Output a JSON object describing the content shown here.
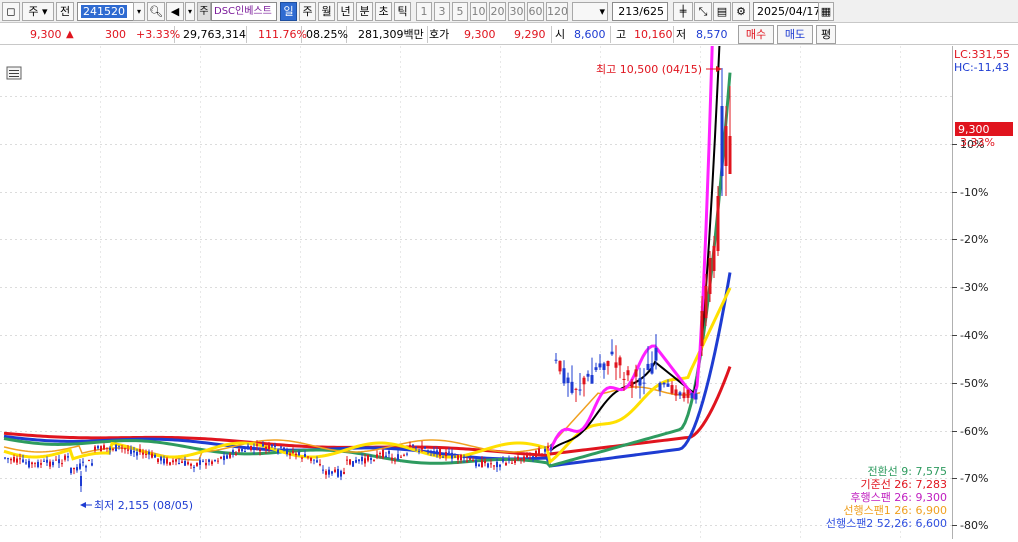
{
  "toolbar": {
    "type_label": "주",
    "period_label": "전",
    "code": "241520",
    "stock_name": "DSC인베스트",
    "period_buttons": [
      "일",
      "주",
      "월",
      "년",
      "분",
      "초",
      "틱"
    ],
    "interval_buttons": [
      "1",
      "3",
      "5",
      "10",
      "20",
      "30",
      "60",
      "120"
    ],
    "count": "213/625",
    "date": "2025/04/17"
  },
  "info": {
    "price": "9,300",
    "up_arrow": "▲",
    "change": "300",
    "change_pct": "+3.33%",
    "volume": "29,763,314",
    "volume_ratio": "111.76%",
    "turnover": "08.25%",
    "amount": "281,309백만",
    "quote_label": "호가",
    "ask": "9,300",
    "bid": "9,290",
    "open_label": "시",
    "open": "8,600",
    "high_label": "고",
    "high": "10,160",
    "low_label": "저",
    "low": "8,570",
    "buy_button": "매수",
    "sell_button": "매도",
    "eval_button": "평"
  },
  "chart": {
    "lc_label": "LC:331,55",
    "hc_label": "HC:-11,43",
    "y_ticks": [
      "10%",
      "-10%",
      "-20%",
      "-30%",
      "-40%",
      "-50%",
      "-60%",
      "-70%",
      "-80%"
    ],
    "price_tag": "9,300",
    "price_pct": "3.33%",
    "high_annotation": "최고 10,500 (04/15)",
    "low_annotation": "최저 2,155 (08/05)",
    "legend": [
      {
        "label": "전환선 9: 7,575",
        "color": "#2e9b5f"
      },
      {
        "label": "기준선 26: 7,283",
        "color": "#e0141e"
      },
      {
        "label": "후행스팬 26: 9,300",
        "color": "#c020c0"
      },
      {
        "label": "선행스팬1 26: 6,900",
        "color": "#f0a020"
      },
      {
        "label": "선행스팬2 52,26: 6,600",
        "color": "#3050e0"
      }
    ],
    "colors": {
      "up": "#e0141e",
      "down": "#1e3cd2",
      "ma5": "#ff20ff",
      "ma10": "#000000",
      "ma20": "#ffe000",
      "ma60": "#2e9b5f",
      "ma120": "#1e3cd2",
      "ma240": "#e0141e",
      "span": "#f0a020"
    }
  }
}
